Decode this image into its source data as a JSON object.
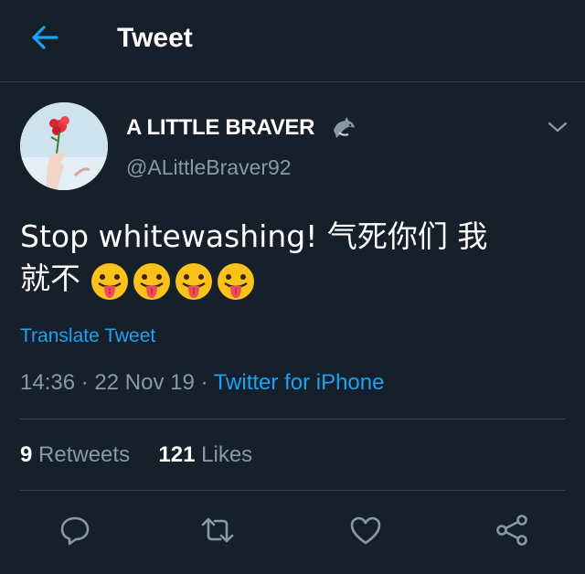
{
  "header": {
    "title": "Tweet",
    "back_icon": "arrow-left-icon"
  },
  "author": {
    "display_name": "A LITTLE BRAVER",
    "badge_icon": "dolphin-emoji-icon",
    "handle": "@ALittleBraver92",
    "avatar": "avatar-hand-holding-red-flower"
  },
  "tweet": {
    "text_line1": "Stop whitewashing! 气死你们 我",
    "text_line2": "就不",
    "emojis": [
      "tongue-out-emoji",
      "tongue-out-emoji",
      "tongue-out-emoji",
      "tongue-out-emoji"
    ],
    "translate_label": "Translate Tweet",
    "time": "14:36",
    "date": "22 Nov 19",
    "separator": "·",
    "source": "Twitter for iPhone"
  },
  "stats": {
    "retweets_count": "9",
    "retweets_label": "Retweets",
    "likes_count": "121",
    "likes_label": "Likes"
  },
  "actions": [
    "reply-icon",
    "retweet-icon",
    "like-icon",
    "share-icon"
  ],
  "colors": {
    "background": "#15202b",
    "accent": "#1da1f2",
    "secondary_text": "#8899a6",
    "divider": "#38444d"
  }
}
